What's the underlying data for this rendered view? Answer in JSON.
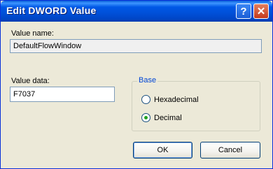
{
  "dialog": {
    "title": "Edit DWORD Value",
    "help_glyph": "?",
    "close_glyph": "✕"
  },
  "value_name": {
    "label": "Value name:",
    "value": "DefaultFlowWindow"
  },
  "value_data": {
    "label": "Value data:",
    "value": "F7037"
  },
  "base": {
    "legend": "Base",
    "options": [
      {
        "label": "Hexadecimal",
        "selected": false
      },
      {
        "label": "Decimal",
        "selected": true
      }
    ]
  },
  "buttons": {
    "ok": "OK",
    "cancel": "Cancel"
  },
  "colors": {
    "titlebar": "#0058e6",
    "close": "#c4391c",
    "group_legend": "#0046d5",
    "radio_selected": "#21a121"
  },
  "icons": [
    "help-icon",
    "close-icon"
  ]
}
